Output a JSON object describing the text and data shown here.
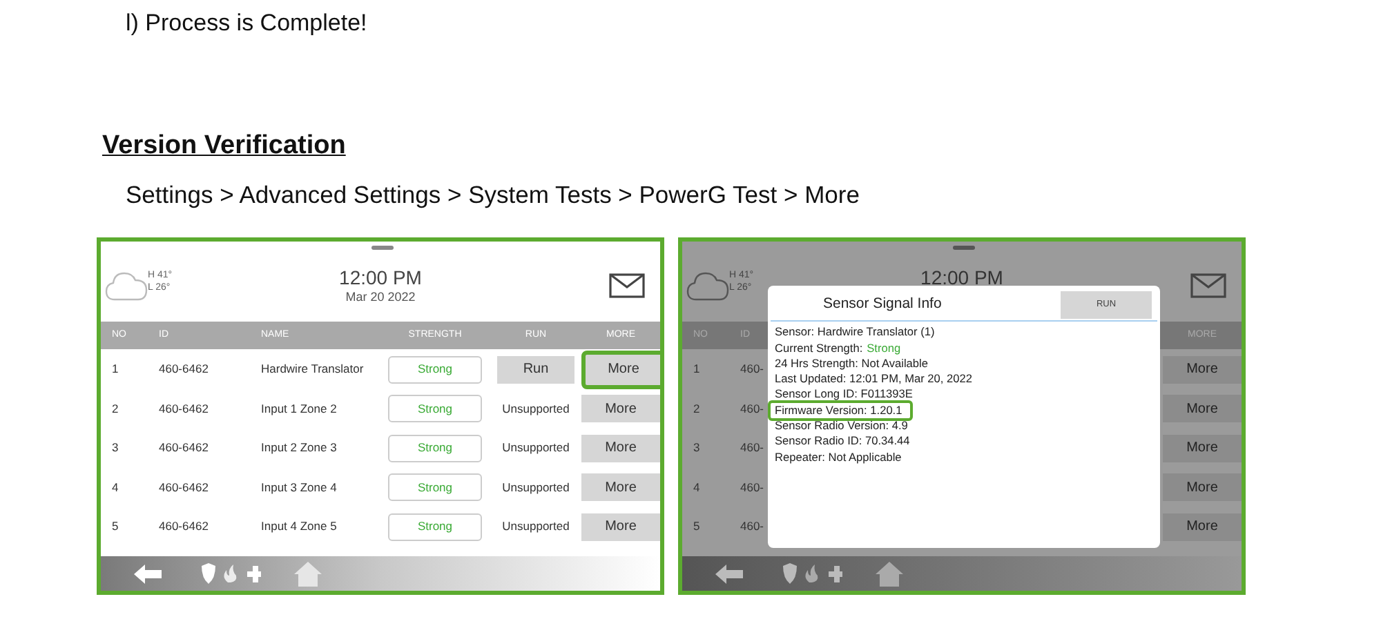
{
  "step": "l) Process is Complete!",
  "section_title": "Version Verification",
  "breadcrumb": "Settings > Advanced Settings > System Tests > PowerG Test > More",
  "panels": [
    {
      "dimmed": false,
      "weather": {
        "high": "H 41°",
        "low": "L 26°"
      },
      "time": "12:00 PM",
      "date": "Mar 20 2022",
      "columns": [
        {
          "kind": "no",
          "label": "NO"
        },
        {
          "kind": "id",
          "label": "ID"
        },
        {
          "kind": "name",
          "label": "NAME"
        },
        {
          "kind": "strength",
          "label": "STRENGTH"
        },
        {
          "kind": "run",
          "label": "RUN"
        },
        {
          "kind": "more",
          "label": "MORE"
        }
      ],
      "rows": [
        {
          "no": "1",
          "id": "460-6462",
          "name": "Hardwire Translator",
          "strength": "Strong",
          "run": {
            "kind": "button",
            "label": "Run"
          },
          "more": "More",
          "highlighted": true
        },
        {
          "no": "2",
          "id": "460-6462",
          "name": "Input 1 Zone 2",
          "strength": "Strong",
          "run": {
            "kind": "text",
            "label": "Unsupported"
          },
          "more": "More",
          "highlighted": false
        },
        {
          "no": "3",
          "id": "460-6462",
          "name": "Input 2 Zone 3",
          "strength": "Strong",
          "run": {
            "kind": "text",
            "label": "Unsupported"
          },
          "more": "More",
          "highlighted": false
        },
        {
          "no": "4",
          "id": "460-6462",
          "name": "Input 3 Zone 4",
          "strength": "Strong",
          "run": {
            "kind": "text",
            "label": "Unsupported"
          },
          "more": "More",
          "highlighted": false
        },
        {
          "no": "5",
          "id": "460-6462",
          "name": "Input 4 Zone 5",
          "strength": "Strong",
          "run": {
            "kind": "text",
            "label": "Unsupported"
          },
          "more": "More",
          "highlighted": false
        }
      ]
    },
    {
      "dimmed": true,
      "weather": {
        "high": "H 41°",
        "low": "L 26°"
      },
      "time": "12:00 PM",
      "columns": [
        {
          "kind": "no",
          "label": "NO"
        },
        {
          "kind": "id",
          "label": "ID"
        },
        {
          "kind": "more",
          "label": "MORE"
        }
      ],
      "rows": [
        {
          "no": "1",
          "id": "460-",
          "more": "More",
          "highlighted": false
        },
        {
          "no": "2",
          "id": "460-",
          "more": "More",
          "highlighted": false
        },
        {
          "no": "3",
          "id": "460-",
          "more": "More",
          "highlighted": false
        },
        {
          "no": "4",
          "id": "460-",
          "more": "More",
          "highlighted": false
        },
        {
          "no": "5",
          "id": "460-",
          "more": "More",
          "highlighted": false
        }
      ],
      "dialog": {
        "title": "Sensor Signal Info",
        "button": "RUN",
        "lines": [
          {
            "kind": "text",
            "text": "Sensor: Hardwire Translator (1)",
            "highlighted": false
          },
          {
            "kind": "status",
            "text": "Current Strength:",
            "value": "Strong",
            "highlighted": false
          },
          {
            "kind": "text",
            "text": "24 Hrs Strength: Not Available",
            "highlighted": false
          },
          {
            "kind": "text",
            "text": "Last Updated: 12:01 PM, Mar 20, 2022",
            "highlighted": false
          },
          {
            "kind": "text",
            "text": "Sensor Long ID: F011393E",
            "highlighted": false
          },
          {
            "kind": "text",
            "text": "Firmware Version: 1.20.1",
            "highlighted": true
          },
          {
            "kind": "text",
            "text": "Sensor Radio Version: 4.9",
            "highlighted": false
          },
          {
            "kind": "text",
            "text": "Sensor Radio ID: 70.34.44",
            "highlighted": false
          },
          {
            "kind": "text",
            "text": "Repeater: Not Applicable",
            "highlighted": false
          }
        ]
      }
    }
  ]
}
